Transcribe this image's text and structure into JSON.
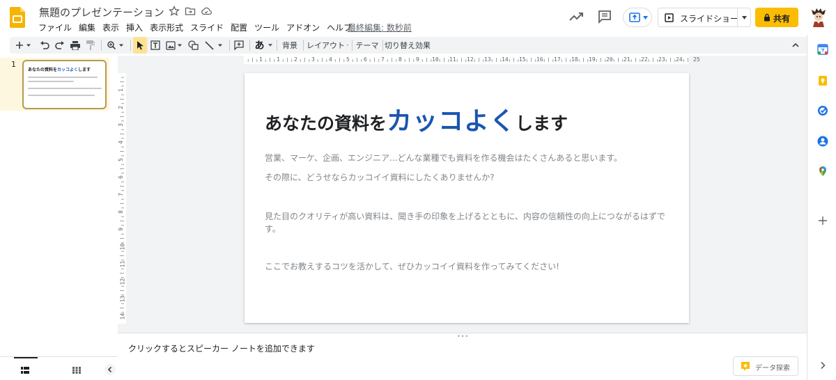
{
  "header": {
    "title": "無題のプレゼンテーション",
    "menu": [
      "ファイル",
      "編集",
      "表示",
      "挿入",
      "表示形式",
      "スライド",
      "配置",
      "ツール",
      "アドオン",
      "ヘルプ"
    ],
    "last_edit": "最終編集: 数秒前",
    "slideshow_label": "スライドショー",
    "share_label": "共有"
  },
  "toolbar": {
    "background": "背景",
    "layout": "レイアウト",
    "theme": "テーマ",
    "transition": "切り替え効果",
    "input_tool": "あ"
  },
  "filmstrip": {
    "slide_number": "1",
    "thumb_title_a": "あなたの資料を",
    "thumb_title_b": "カッコよく",
    "thumb_title_c": "します"
  },
  "rulers": {
    "top": [
      "1",
      "1",
      "2",
      "3",
      "4",
      "5",
      "6",
      "7",
      "8",
      "9",
      "10",
      "11",
      "12",
      "13",
      "14",
      "15",
      "16",
      "17",
      "18",
      "19",
      "20",
      "21",
      "22",
      "23",
      "24",
      "25"
    ],
    "left": [
      "1",
      "2",
      "3",
      "4",
      "5",
      "6",
      "7",
      "8",
      "9",
      "10",
      "11",
      "12",
      "13",
      "14"
    ]
  },
  "slide": {
    "title_a": "あなたの資料を",
    "title_b": "カッコよく",
    "title_c": "します",
    "p1": "営業、マーケ、企画、エンジニア...どんな業種でも資料を作る機会はたくさんあると思います。",
    "p2": "その際に、どうせならカッコイイ資料にしたくありませんか?",
    "p3": "見た目のクオリティが高い資料は、聞き手の印象を上げるとともに、内容の信頼性の向上につながるはずです。",
    "p4": "ここでお教えするコツを活かして、ぜひカッコイイ資料を作ってみてください!"
  },
  "notes_placeholder": "クリックするとスピーカー ノートを追加できます",
  "explore_label": "データ探索",
  "colors": {
    "accent_blue": "#1a56b0",
    "share_yellow": "#fbbc04",
    "slides_yellow": "#f4b400"
  },
  "icons": [
    "slides-logo",
    "star-icon",
    "move-folder-icon",
    "cloud-icon",
    "activity-trend-icon",
    "comments-icon",
    "present-options-icon",
    "slideshow-play-icon",
    "lock-icon",
    "avatar",
    "new-slide-icon",
    "undo-icon",
    "redo-icon",
    "print-icon",
    "paint-format-icon",
    "zoom-icon",
    "select-cursor-icon",
    "textbox-icon",
    "image-icon",
    "shape-icon",
    "line-icon",
    "comment-add-icon",
    "collapse-toolbar-icon",
    "filmstrip-view-icon",
    "grid-view-icon",
    "hide-panel-icon",
    "explore-icon",
    "calendar-icon",
    "keep-icon",
    "tasks-icon",
    "contacts-icon",
    "maps-icon",
    "add-addon-icon",
    "expand-panel-icon"
  ]
}
